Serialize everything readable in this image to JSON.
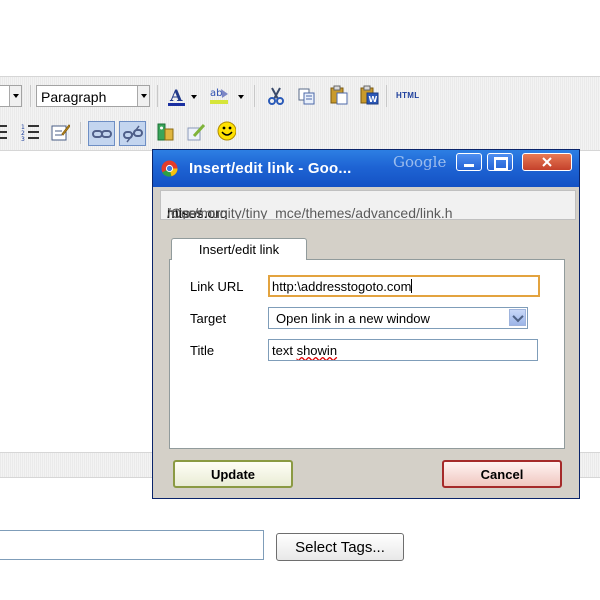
{
  "toolbar": {
    "format_select": "Paragraph",
    "html_label": "HTML",
    "icons": {
      "font_color": "A",
      "highlight": "ab"
    }
  },
  "dialog": {
    "window_title": "Insert/edit link - Goo...",
    "google_watermark": "Google",
    "address_prefix": "http://",
    "address_host": "mises.org",
    "address_path": "/Community/tiny_mce/themes/advanced/link.h",
    "tab_label": "Insert/edit link",
    "link_url_label": "Link URL",
    "link_url_value": "http:\\addresstogoto.com",
    "target_label": "Target",
    "target_value": "Open link in a new window",
    "title_label": "Title",
    "title_value_part1": "text ",
    "title_value_part2": "showin",
    "update_button": "Update",
    "cancel_button": "Cancel"
  },
  "page": {
    "select_tags_button": "Select Tags..."
  },
  "colors": {
    "titlebar": "#1e64d4",
    "update_border": "#8b9a43",
    "cancel_border": "#a52a2a",
    "focus_border": "#e3a33f"
  }
}
